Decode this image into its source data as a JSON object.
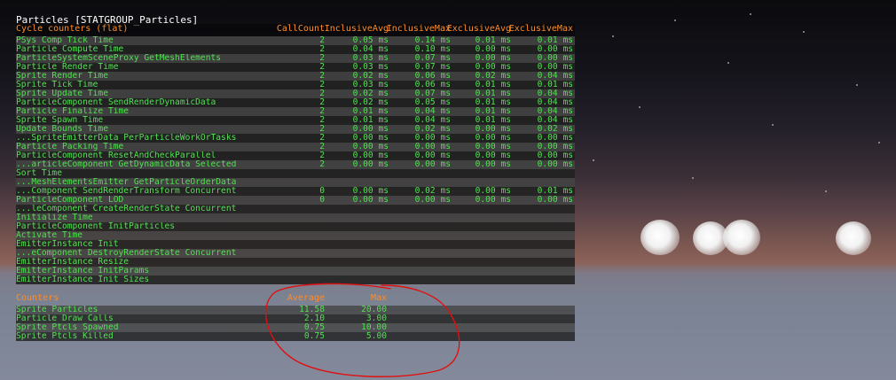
{
  "title": "Particles [STATGROUP_Particles]",
  "cycle": {
    "section_label": "Cycle counters (flat)",
    "headers": [
      "CallCount",
      "InclusiveAvg",
      "InclusiveMax",
      "ExclusiveAvg",
      "ExclusiveMax"
    ],
    "rows": [
      [
        "PSys Comp Tick Time",
        "2",
        "0.05 ms",
        "0.14 ms",
        "0.01 ms",
        "0.01 ms"
      ],
      [
        "Particle Compute Time",
        "2",
        "0.04 ms",
        "0.10 ms",
        "0.00 ms",
        "0.00 ms"
      ],
      [
        "ParticleSystemSceneProxy GetMeshElements",
        "2",
        "0.03 ms",
        "0.07 ms",
        "0.00 ms",
        "0.00 ms"
      ],
      [
        "Particle Render Time",
        "2",
        "0.03 ms",
        "0.07 ms",
        "0.00 ms",
        "0.00 ms"
      ],
      [
        "Sprite Render Time",
        "2",
        "0.02 ms",
        "0.06 ms",
        "0.02 ms",
        "0.04 ms"
      ],
      [
        "Sprite Tick Time",
        "2",
        "0.03 ms",
        "0.06 ms",
        "0.01 ms",
        "0.01 ms"
      ],
      [
        "Sprite Update Time",
        "2",
        "0.02 ms",
        "0.07 ms",
        "0.01 ms",
        "0.04 ms"
      ],
      [
        "ParticleComponent SendRenderDynamicData",
        "2",
        "0.02 ms",
        "0.05 ms",
        "0.01 ms",
        "0.04 ms"
      ],
      [
        "Particle Finalize Time",
        "2",
        "0.01 ms",
        "0.04 ms",
        "0.01 ms",
        "0.04 ms"
      ],
      [
        "Sprite Spawn Time",
        "2",
        "0.01 ms",
        "0.04 ms",
        "0.01 ms",
        "0.04 ms"
      ],
      [
        "Update Bounds Time",
        "2",
        "0.00 ms",
        "0.02 ms",
        "0.00 ms",
        "0.02 ms"
      ],
      [
        "...SpriteEmitterData PerParticleWorkOrTasks",
        "2",
        "0.00 ms",
        "0.00 ms",
        "0.00 ms",
        "0.00 ms"
      ],
      [
        "Particle Packing Time",
        "2",
        "0.00 ms",
        "0.00 ms",
        "0.00 ms",
        "0.00 ms"
      ],
      [
        "ParticleComponent ResetAndCheckParallel",
        "2",
        "0.00 ms",
        "0.00 ms",
        "0.00 ms",
        "0.00 ms"
      ],
      [
        "...articleComponent GetDynamicData Selected",
        "2",
        "0.00 ms",
        "0.00 ms",
        "0.00 ms",
        "0.00 ms"
      ],
      [
        "Sort Time",
        "",
        "",
        "",
        "",
        ""
      ],
      [
        "...MeshElementsEmitter GetParticleOrderData",
        "",
        "",
        "",
        "",
        ""
      ],
      [
        "...Component SendRenderTransform Concurrent",
        "0",
        "0.00 ms",
        "0.02 ms",
        "0.00 ms",
        "0.01 ms"
      ],
      [
        "ParticleComponent LOD",
        "0",
        "0.00 ms",
        "0.00 ms",
        "0.00 ms",
        "0.00 ms"
      ],
      [
        "...leComponent CreateRenderState Concurrent",
        "",
        "",
        "",
        "",
        ""
      ],
      [
        "Initialize Time",
        "",
        "",
        "",
        "",
        ""
      ],
      [
        "ParticleComponent InitParticles",
        "",
        "",
        "",
        "",
        ""
      ],
      [
        "Activate Time",
        "",
        "",
        "",
        "",
        ""
      ],
      [
        "EmitterInstance Init",
        "",
        "",
        "",
        "",
        ""
      ],
      [
        "...eComponent DestroyRenderState Concurrent",
        "",
        "",
        "",
        "",
        ""
      ],
      [
        "EmitterInstance Resize",
        "",
        "",
        "",
        "",
        ""
      ],
      [
        "EmitterInstance InitParams",
        "",
        "",
        "",
        "",
        ""
      ],
      [
        "EmitterInstance Init Sizes",
        "",
        "",
        "",
        "",
        ""
      ]
    ]
  },
  "counters": {
    "section_label": "Counters",
    "headers": [
      "Average",
      "Max"
    ],
    "rows": [
      [
        "Sprite Particles",
        "11.58",
        "20.00"
      ],
      [
        "Particle Draw Calls",
        "2.10",
        "3.00"
      ],
      [
        "Sprite Ptcls Spawned",
        "0.75",
        "10.00"
      ],
      [
        "Sprite Ptcls Killed",
        "0.75",
        "5.00"
      ]
    ]
  },
  "colors": {
    "title": "#ffffff",
    "header": "#ff8c2a",
    "value": "#52e052",
    "annotation": "#e01010"
  }
}
